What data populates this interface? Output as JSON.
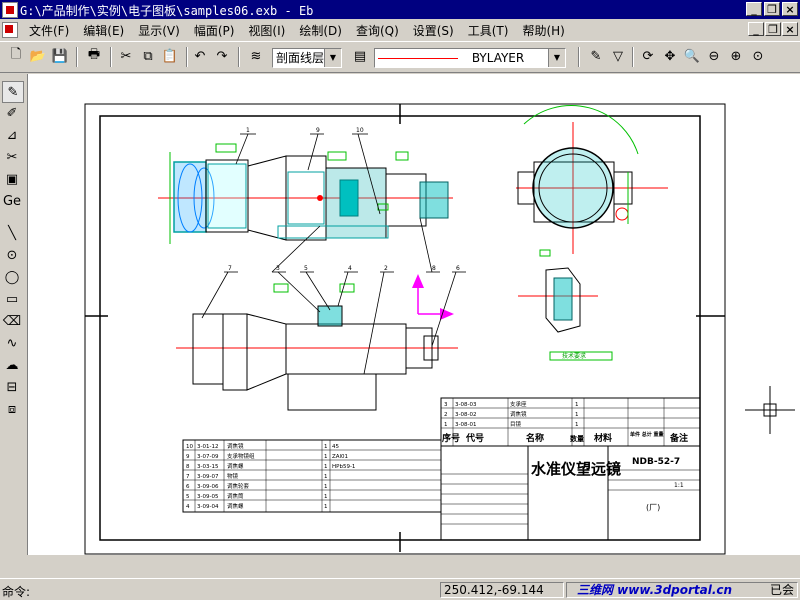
{
  "window": {
    "title": "G:\\产品制作\\实例\\电子图板\\samples06.exb - Eb"
  },
  "menu": [
    "文件(F)",
    "编辑(E)",
    "显示(V)",
    "幅面(P)",
    "视图(I)",
    "绘制(D)",
    "查询(Q)",
    "设置(S)",
    "工具(T)",
    "帮助(H)"
  ],
  "toolbar": {
    "hatch_combo": "剖面线层",
    "linetype_combo": "BYLAYER"
  },
  "drawing": {
    "title_block_name": "水准仪望远镜",
    "drawing_no": "NDB-52-7",
    "factory": "(厂)",
    "header_seq": "序号",
    "header_code": "代号",
    "header_name": "名称",
    "header_qty": "数量",
    "header_material": "材料",
    "header_weight": "单件 总计 重量",
    "header_note": "备注",
    "scale": "1:1",
    "tech_req": "技术要求",
    "bom_rows": [
      {
        "no": "3",
        "code": "3-08-03",
        "name": "支承座",
        "qty": "1"
      },
      {
        "no": "2",
        "code": "3-08-02",
        "name": "调焦镜",
        "qty": "1"
      },
      {
        "no": "1",
        "code": "3-08-01",
        "name": "目镜",
        "qty": "1"
      }
    ],
    "left_rows": [
      {
        "no": "10",
        "code": "3-01-12",
        "name": "调焦镜",
        "qty": "1",
        "mat": "45"
      },
      {
        "no": "9",
        "code": "3-07-09",
        "name": "支承物镜组",
        "qty": "1",
        "mat": "ZAl01"
      },
      {
        "no": "8",
        "code": "3-03-15",
        "name": "调焦螺",
        "qty": "1",
        "mat": "HPb59-1"
      },
      {
        "no": "7",
        "code": "3-09-07",
        "name": "物镜",
        "qty": "1",
        "mat": ""
      },
      {
        "no": "6",
        "code": "3-09-06",
        "name": "调焦轮套",
        "qty": "1",
        "mat": ""
      },
      {
        "no": "5",
        "code": "3-09-05",
        "name": "调焦筒",
        "qty": "1",
        "mat": ""
      },
      {
        "no": "4",
        "code": "3-09-04",
        "name": "调焦螺",
        "qty": "1",
        "mat": ""
      }
    ],
    "balloons": [
      "1",
      "9",
      "10",
      "7",
      "3",
      "5",
      "4",
      "2",
      "8",
      "6"
    ]
  },
  "command": {
    "label": "命令:",
    "coords": "250.412,-69.144"
  },
  "status": {
    "watermark": "三维网 www.3dportal.cn",
    "right": "已会"
  },
  "colors": {
    "titlebar": "#000080",
    "cyan": "#00c0c0",
    "red": "#ff0000",
    "green": "#00c000",
    "magenta": "#ff00ff"
  }
}
